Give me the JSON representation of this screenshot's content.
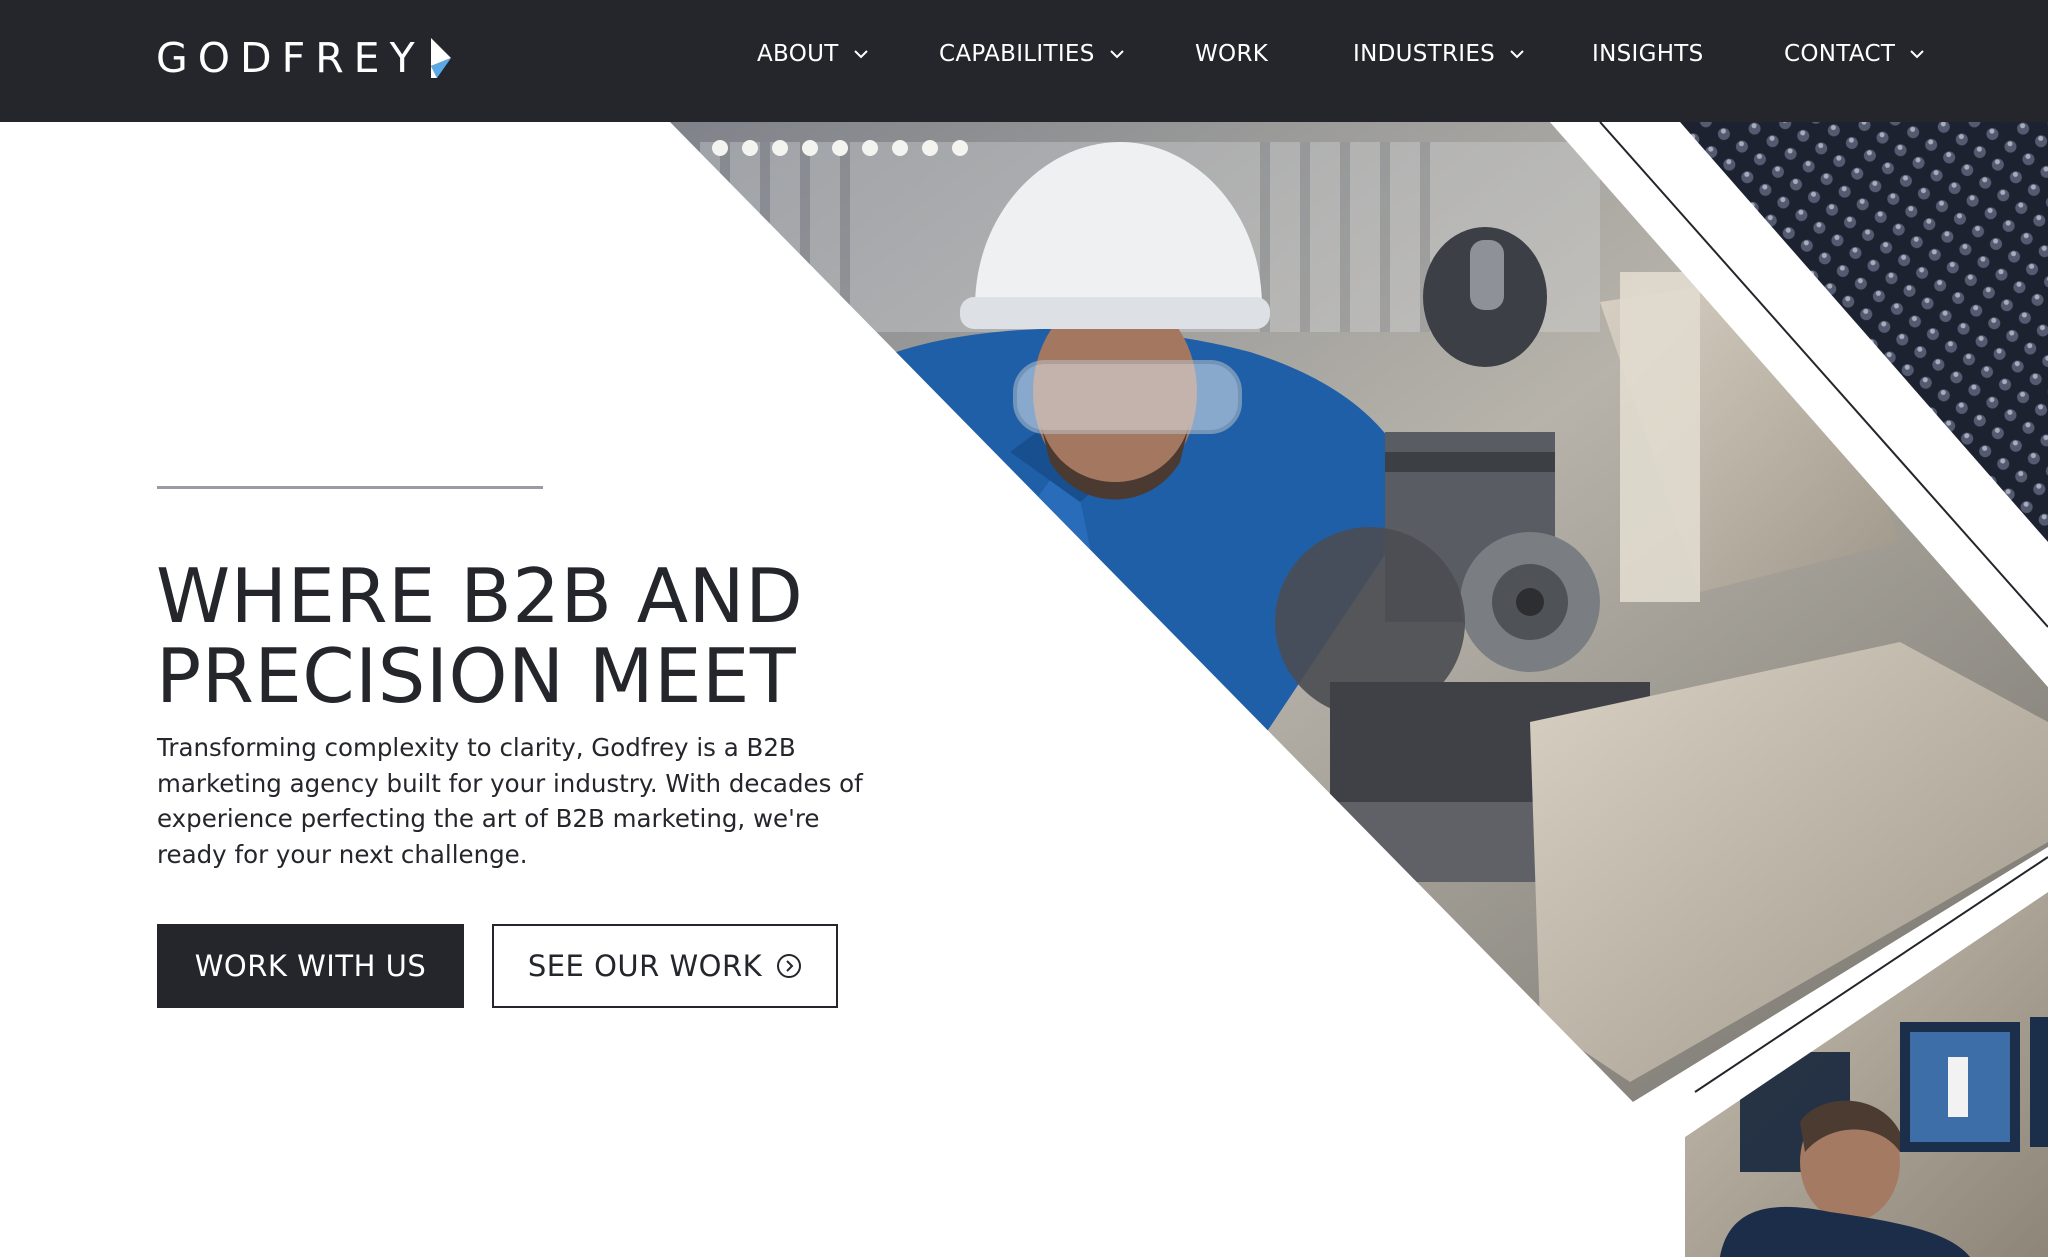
{
  "brand": {
    "name": "GODFREY",
    "logo_icon": "chevron-arrow-logo-mark",
    "accent": "#5aa9e6"
  },
  "nav": {
    "items": [
      {
        "label": "ABOUT",
        "has_dropdown": true
      },
      {
        "label": "CAPABILITIES",
        "has_dropdown": true
      },
      {
        "label": "WORK",
        "has_dropdown": false
      },
      {
        "label": "INDUSTRIES",
        "has_dropdown": true
      },
      {
        "label": "INSIGHTS",
        "has_dropdown": false
      },
      {
        "label": "CONTACT",
        "has_dropdown": true
      }
    ]
  },
  "hero": {
    "title_lines": [
      "WHERE B2B AND",
      "PRECISION MEET"
    ],
    "body_lines": [
      "Transforming complexity to clarity, Godfrey is a B2B",
      "marketing agency built for your industry. With decades of",
      "experience perfecting the art of B2B marketing, we're",
      "ready for your next challenge."
    ],
    "primary_cta": "WORK WITH US",
    "secondary_cta": "SEE OUR WORK",
    "secondary_cta_icon": "circle-chevron-right-icon"
  },
  "colors": {
    "header_bg": "#24262b",
    "text_dark": "#24262b",
    "workwear_blue": "#1f5fa8"
  }
}
